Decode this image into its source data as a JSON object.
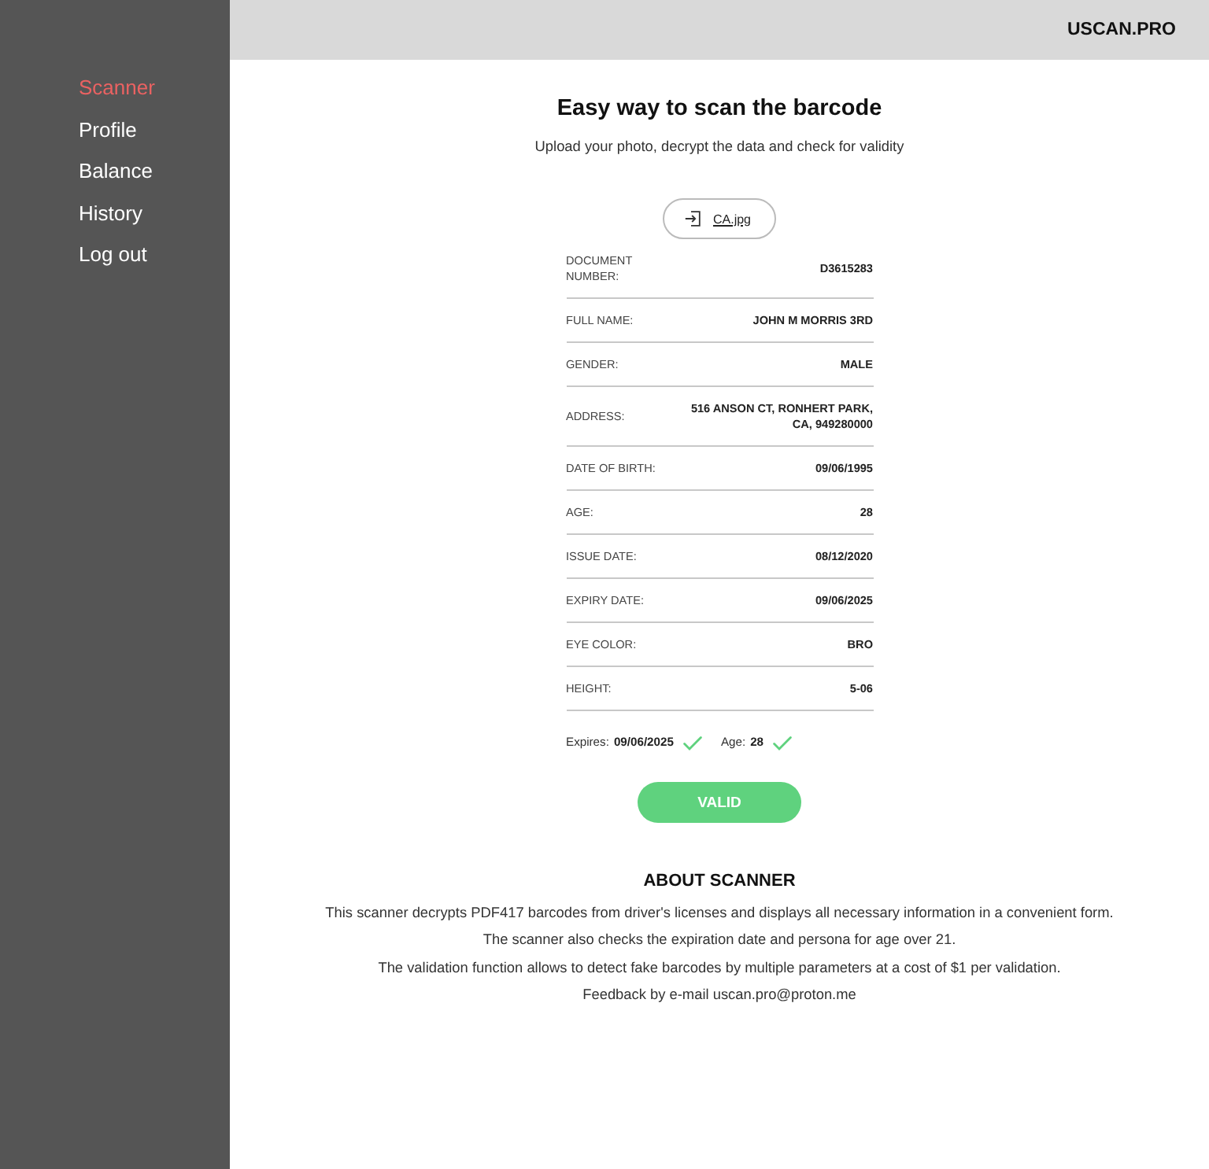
{
  "header": {
    "brand": "USCAN.PRO"
  },
  "sidebar": {
    "items": [
      {
        "label": "Scanner",
        "selected": true
      },
      {
        "label": "Profile",
        "selected": false
      },
      {
        "label": "Balance",
        "selected": false
      },
      {
        "label": "History",
        "selected": false
      },
      {
        "label": "Log out",
        "selected": false
      }
    ]
  },
  "scanner": {
    "title": "Easy way to scan the barcode",
    "subtitle": "Upload your photo, decrypt the data and check for validity",
    "file": {
      "name": "CA.jpg"
    },
    "fields": [
      {
        "label": "DOCUMENT NUMBER:",
        "value": "D3615283"
      },
      {
        "label": "FULL NAME:",
        "value": "JOHN M MORRIS 3RD"
      },
      {
        "label": "GENDER:",
        "value": "MALE"
      },
      {
        "label": "ADDRESS:",
        "value": "516 ANSON CT, RONHERT PARK, CA, 949280000"
      },
      {
        "label": "DATE OF BIRTH:",
        "value": "09/06/1995"
      },
      {
        "label": "AGE:",
        "value": "28"
      },
      {
        "label": "ISSUE DATE:",
        "value": "08/12/2020"
      },
      {
        "label": "EXPIRY DATE:",
        "value": "09/06/2025"
      },
      {
        "label": "EYE COLOR:",
        "value": "BRO"
      },
      {
        "label": "HEIGHT:",
        "value": "5-06"
      }
    ],
    "checks": [
      {
        "label": "Expires:",
        "value": "09/06/2025",
        "passed": true
      },
      {
        "label": "Age:",
        "value": "28",
        "passed": true
      }
    ],
    "result": {
      "label": "VALID",
      "valid": true
    }
  },
  "about": {
    "title": "ABOUT SCANNER",
    "lines": [
      "This scanner decrypts PDF417 barcodes from driver's licenses and displays all necessary information in a convenient form.",
      "The scanner also checks the expiration date and persona for age over 21.",
      "The validation function allows to detect fake barcodes by multiple parameters at a cost of $1 per validation.",
      "Feedback by e-mail uscan.pro@proton.me"
    ]
  }
}
